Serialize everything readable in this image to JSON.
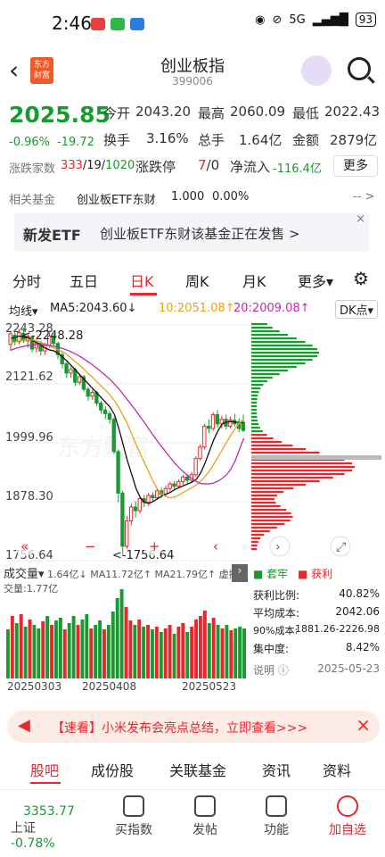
{
  "status": {
    "time": "2:46",
    "net": "5G",
    "battery": "93"
  },
  "header": {
    "title": "创业板指",
    "code": "399006",
    "logo_text": "东方财富",
    "back": "‹"
  },
  "quote": {
    "price": "2025.85",
    "pct": "-0.96%",
    "chg": "-19.72",
    "open_l": "今开",
    "open": "2043.20",
    "high_l": "最高",
    "high": "2060.09",
    "low_l": "最低",
    "low": "2022.43",
    "turn_l": "换手",
    "turn": "3.16%",
    "hand_l": "总手",
    "hand": "1.64亿",
    "amt_l": "金额",
    "amt": "2879亿",
    "count_l": "涨跌家数",
    "up": "333",
    "slash1": "/",
    "flat": "19",
    "slash2": "/",
    "down": "1020",
    "limit_l": "涨跌停",
    "limit_up": "7",
    "limit_sep": "/",
    "limit_down": "0",
    "inflow_l": "净流入",
    "inflow": "-116.4亿",
    "more": "更多"
  },
  "fund": {
    "label": "相关基金",
    "name": "创业板ETF东财",
    "price": "1.000",
    "pct": "0.00%",
    "arrow": "-- >"
  },
  "banner": {
    "tag": "新发ETF",
    "text": "创业板ETF东财该基金正在发售 >",
    "close": "×"
  },
  "tabs": [
    "分时",
    "五日",
    "日K",
    "周K",
    "月K",
    "更多▾"
  ],
  "ma": {
    "label": "均线▾",
    "ma5": "MA5:2043.60↓",
    "ma10": "10:2051.08↑",
    "ma20": "20:2009.08↑",
    "dk": "DK点▾"
  },
  "chart_data": {
    "type": "candlestick",
    "y_ticks": [
      "2243.28",
      "2121.62",
      "1999.96",
      "1878.30",
      "1756.64"
    ],
    "annot_high": "<-2248.28",
    "annot_low": "<-1756.64",
    "watermark": "东方财富",
    "dates": [
      "20250303",
      "20250408",
      "20250523"
    ],
    "candles": [
      [
        2212,
        2235,
        2198,
        2240
      ],
      [
        2232,
        2218,
        2210,
        2242
      ],
      [
        2218,
        2238,
        2212,
        2246
      ],
      [
        2236,
        2220,
        2215,
        2248
      ],
      [
        2220,
        2230,
        2205,
        2236
      ],
      [
        2228,
        2202,
        2195,
        2232
      ],
      [
        2204,
        2215,
        2195,
        2222
      ],
      [
        2215,
        2198,
        2188,
        2220
      ],
      [
        2198,
        2210,
        2190,
        2216
      ],
      [
        2210,
        2230,
        2205,
        2238
      ],
      [
        2230,
        2214,
        2208,
        2236
      ],
      [
        2214,
        2190,
        2180,
        2218
      ],
      [
        2190,
        2170,
        2160,
        2195
      ],
      [
        2170,
        2150,
        2140,
        2175
      ],
      [
        2150,
        2158,
        2140,
        2164
      ],
      [
        2158,
        2130,
        2122,
        2162
      ],
      [
        2130,
        2142,
        2124,
        2148
      ],
      [
        2142,
        2115,
        2110,
        2146
      ],
      [
        2115,
        2100,
        2090,
        2120
      ],
      [
        2100,
        2108,
        2092,
        2114
      ],
      [
        2108,
        2085,
        2078,
        2112
      ],
      [
        2085,
        2070,
        2062,
        2090
      ],
      [
        2070,
        2062,
        2050,
        2078
      ],
      [
        2062,
        2050,
        2040,
        2068
      ],
      [
        2050,
        1980,
        1975,
        2055
      ],
      [
        1980,
        1890,
        1870,
        1985
      ],
      [
        1890,
        1775,
        1757,
        1895
      ],
      [
        1775,
        1830,
        1770,
        1840
      ],
      [
        1830,
        1860,
        1820,
        1868
      ],
      [
        1860,
        1852,
        1838,
        1872
      ],
      [
        1852,
        1878,
        1846,
        1884
      ],
      [
        1878,
        1870,
        1860,
        1886
      ],
      [
        1870,
        1885,
        1862,
        1890
      ],
      [
        1885,
        1880,
        1872,
        1892
      ],
      [
        1880,
        1895,
        1875,
        1900
      ],
      [
        1895,
        1888,
        1880,
        1902
      ],
      [
        1888,
        1900,
        1882,
        1906
      ],
      [
        1900,
        1910,
        1894,
        1915
      ],
      [
        1910,
        1905,
        1896,
        1916
      ],
      [
        1905,
        1915,
        1900,
        1920
      ],
      [
        1915,
        1925,
        1908,
        1930
      ],
      [
        1925,
        1918,
        1910,
        1932
      ],
      [
        1918,
        1930,
        1912,
        1936
      ],
      [
        1930,
        1965,
        1925,
        1970
      ],
      [
        1965,
        1990,
        1960,
        1996
      ],
      [
        1990,
        2035,
        1985,
        2040
      ],
      [
        2035,
        2030,
        2020,
        2050
      ],
      [
        2030,
        2060,
        2025,
        2065
      ],
      [
        2060,
        2040,
        2032,
        2070
      ],
      [
        2040,
        2050,
        2030,
        2058
      ],
      [
        2050,
        2035,
        2028,
        2060
      ],
      [
        2035,
        2048,
        2030,
        2056
      ],
      [
        2048,
        2040,
        2034,
        2062
      ],
      [
        2040,
        2030,
        2022,
        2052
      ],
      [
        2043,
        2026,
        2022,
        2060
      ]
    ],
    "ma5": [
      2225,
      2228,
      2230,
      2228,
      2226,
      2220,
      2216,
      2210,
      2204,
      2200,
      2198,
      2192,
      2184,
      2176,
      2166,
      2156,
      2146,
      2136,
      2126,
      2116,
      2106,
      2096,
      2086,
      2076,
      2060,
      2030,
      1995,
      1960,
      1930,
      1900,
      1880,
      1870,
      1868,
      1872,
      1878,
      1884,
      1888,
      1892,
      1898,
      1902,
      1906,
      1910,
      1914,
      1920,
      1934,
      1955,
      1980,
      2005,
      2025,
      2040,
      2044,
      2045,
      2044,
      2043,
      2043
    ],
    "ma10": [
      2215,
      2218,
      2220,
      2221,
      2222,
      2222,
      2220,
      2216,
      2212,
      2208,
      2204,
      2200,
      2196,
      2190,
      2182,
      2174,
      2166,
      2158,
      2148,
      2140,
      2130,
      2121,
      2112,
      2102,
      2090,
      2075,
      2058,
      2040,
      2018,
      1996,
      1975,
      1955,
      1935,
      1915,
      1898,
      1888,
      1882,
      1880,
      1882,
      1886,
      1892,
      1897,
      1902,
      1908,
      1916,
      1926,
      1938,
      1952,
      1968,
      1984,
      2000,
      2016,
      2030,
      2042,
      2051
    ],
    "ma20": [
      2200,
      2203,
      2206,
      2208,
      2210,
      2211,
      2212,
      2212,
      2211,
      2210,
      2208,
      2206,
      2203,
      2200,
      2196,
      2191,
      2186,
      2180,
      2174,
      2167,
      2160,
      2152,
      2144,
      2136,
      2126,
      2116,
      2104,
      2092,
      2080,
      2068,
      2055,
      2042,
      2028,
      2015,
      2002,
      1990,
      1978,
      1966,
      1955,
      1945,
      1936,
      1928,
      1921,
      1915,
      1911,
      1910,
      1910,
      1912,
      1916,
      1922,
      1930,
      1942,
      1960,
      1985,
      2009
    ]
  },
  "vol": {
    "label": "成交量▾",
    "detail": "1.64亿↓ MA11.72亿↑ MA21.79亿↑ 虚拟成交量:1.77亿",
    "bars": [
      [
        0,
        0.55
      ],
      [
        1,
        0.7
      ],
      [
        0,
        0.62
      ],
      [
        1,
        0.72
      ],
      [
        0,
        0.58
      ],
      [
        1,
        0.66
      ],
      [
        0,
        0.6
      ],
      [
        0,
        0.56
      ],
      [
        1,
        0.64
      ],
      [
        0,
        0.7
      ],
      [
        1,
        0.6
      ],
      [
        0,
        0.65
      ],
      [
        0,
        0.68
      ],
      [
        1,
        0.55
      ],
      [
        0,
        0.62
      ],
      [
        0,
        0.7
      ],
      [
        1,
        0.6
      ],
      [
        0,
        0.66
      ],
      [
        0,
        0.72
      ],
      [
        1,
        0.56
      ],
      [
        0,
        0.6
      ],
      [
        0,
        0.65
      ],
      [
        1,
        0.55
      ],
      [
        0,
        0.6
      ],
      [
        0,
        0.75
      ],
      [
        0,
        0.9
      ],
      [
        0,
        1.0
      ],
      [
        1,
        0.8
      ],
      [
        1,
        0.65
      ],
      [
        0,
        0.6
      ],
      [
        1,
        0.66
      ],
      [
        0,
        0.58
      ],
      [
        1,
        0.6
      ],
      [
        0,
        0.55
      ],
      [
        1,
        0.58
      ],
      [
        0,
        0.52
      ],
      [
        1,
        0.56
      ],
      [
        1,
        0.6
      ],
      [
        0,
        0.5
      ],
      [
        1,
        0.58
      ],
      [
        1,
        0.62
      ],
      [
        0,
        0.52
      ],
      [
        1,
        0.58
      ],
      [
        1,
        0.66
      ],
      [
        1,
        0.7
      ],
      [
        1,
        0.76
      ],
      [
        0,
        0.62
      ],
      [
        1,
        0.68
      ],
      [
        0,
        0.6
      ],
      [
        1,
        0.56
      ],
      [
        0,
        0.6
      ],
      [
        1,
        0.54
      ],
      [
        0,
        0.56
      ],
      [
        0,
        0.58
      ],
      [
        0,
        0.56
      ]
    ]
  },
  "legend": {
    "trap": "套牢",
    "profit": "获利",
    "ratio_l": "获利比例:",
    "ratio": "40.82%",
    "avg_l": "平均成本:",
    "avg": "2042.06",
    "cost_l": "90%成本:",
    "cost": "1881.26-2226.98",
    "conc_l": "集中度:",
    "conc": "8.42%",
    "note": "说明",
    "date": "2025-05-23"
  },
  "notice": {
    "text": "【速看】小米发布会亮点总结，立即查看>>>",
    "close": "×"
  },
  "bottom_tabs": [
    "股吧",
    "成份股",
    "关联基金",
    "资讯",
    "资料"
  ],
  "dock": {
    "sh_price": "3353.77",
    "sh_name": "上证",
    "sh_pct": "-0.78%",
    "items": [
      "买指数",
      "发帖",
      "功能",
      "加自选"
    ]
  }
}
